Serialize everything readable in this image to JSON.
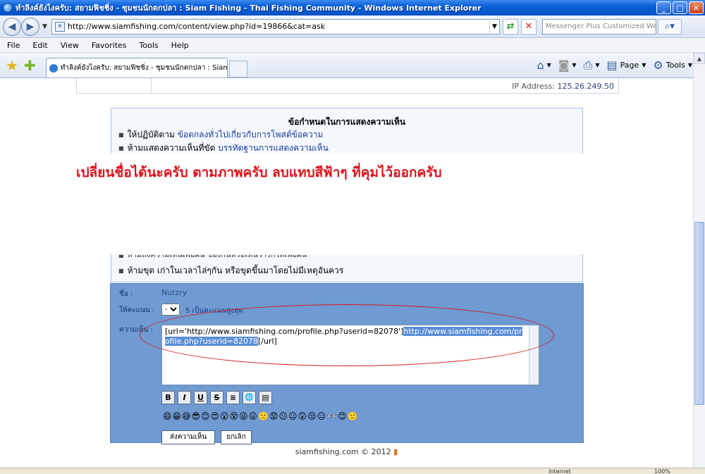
{
  "window": {
    "title": "ทำลิงค์ยังไงครับ: สยามฟิชชิ่ง - ชุมชนนักตกปลา : Siam Fishing - Thai Fishing Community - Windows Internet Explorer",
    "min": "_",
    "max": "□",
    "close": "✕"
  },
  "address": {
    "url": "http://www.siamfishing.com/content/view.php?id=19866&cat=ask",
    "search_placeholder": "Messenger Plus Customized Web Sear"
  },
  "menu": [
    "File",
    "Edit",
    "View",
    "Favorites",
    "Tools",
    "Help"
  ],
  "tab": {
    "title": "ทำลิงค์ยังไงครับ: สยามฟิชชิ่ง - ชุมชนนักตกปลา : Siam Fi..."
  },
  "commands": {
    "page": "Page",
    "tools": "Tools"
  },
  "page": {
    "ip_label": "IP Address:",
    "ip_value": "125.26.249.50",
    "rules": {
      "heading": "ข้อกำหนดในการแสดงความเห็น",
      "item1_prefix": "ให้ปฏิบัติตาม",
      "item1_link": "ข้อตกลงทั่วไปเกี่ยวกับการโพสต์ข้อความ",
      "item2_prefix": "ห้ามแสดงความเห็นที่ขัด",
      "item2_link": "บรรทัดฐานการแสดงความเห็น",
      "item_partial": "ห้ามลงความเห็นเพ้อฝัน ของกันหรือเห็นว่ารักให้เพ้อฝัน",
      "item_last": "ห้ามขุด เก่าในเวลาไล่ๆกัน หรือขุดขึ้นมาโดยไม่มีเหตุอันควร"
    },
    "overlay_message": "เปลี่ยนชื่อได้นะครับ ตามภาพครับ ลบแทบสีฟ้าๆ ที่คุมไว้ออกครับ",
    "form": {
      "name_label": "ชื่อ :",
      "name_value": "Nutzry",
      "score_label": "ให้คะแนน :",
      "score_value": "--",
      "score_hint": "5 เป็นคะแนนสูงสุด",
      "comment_label": "ความเห็น :",
      "comment_part1": "[url='http://www.siamfishing.com/profile.php?userid=82078']",
      "comment_selected": "http://www.siamfishing.com/profile.php?userid=82078",
      "comment_part2": "[/url]",
      "format_buttons": [
        "B",
        "I",
        "U",
        "S",
        "≡",
        "🌐",
        "▤"
      ],
      "smileys": "😄😁😅😎😊😍😮😵😜😛🙁😟😕😐😲😒😑👓😊🙂",
      "submit": "ส่งความเห็น",
      "cancel": "ยกเลิก"
    },
    "footer": "siamfishing.com © 2012"
  },
  "status": {
    "zone": "Internet",
    "zoom": "100%"
  }
}
